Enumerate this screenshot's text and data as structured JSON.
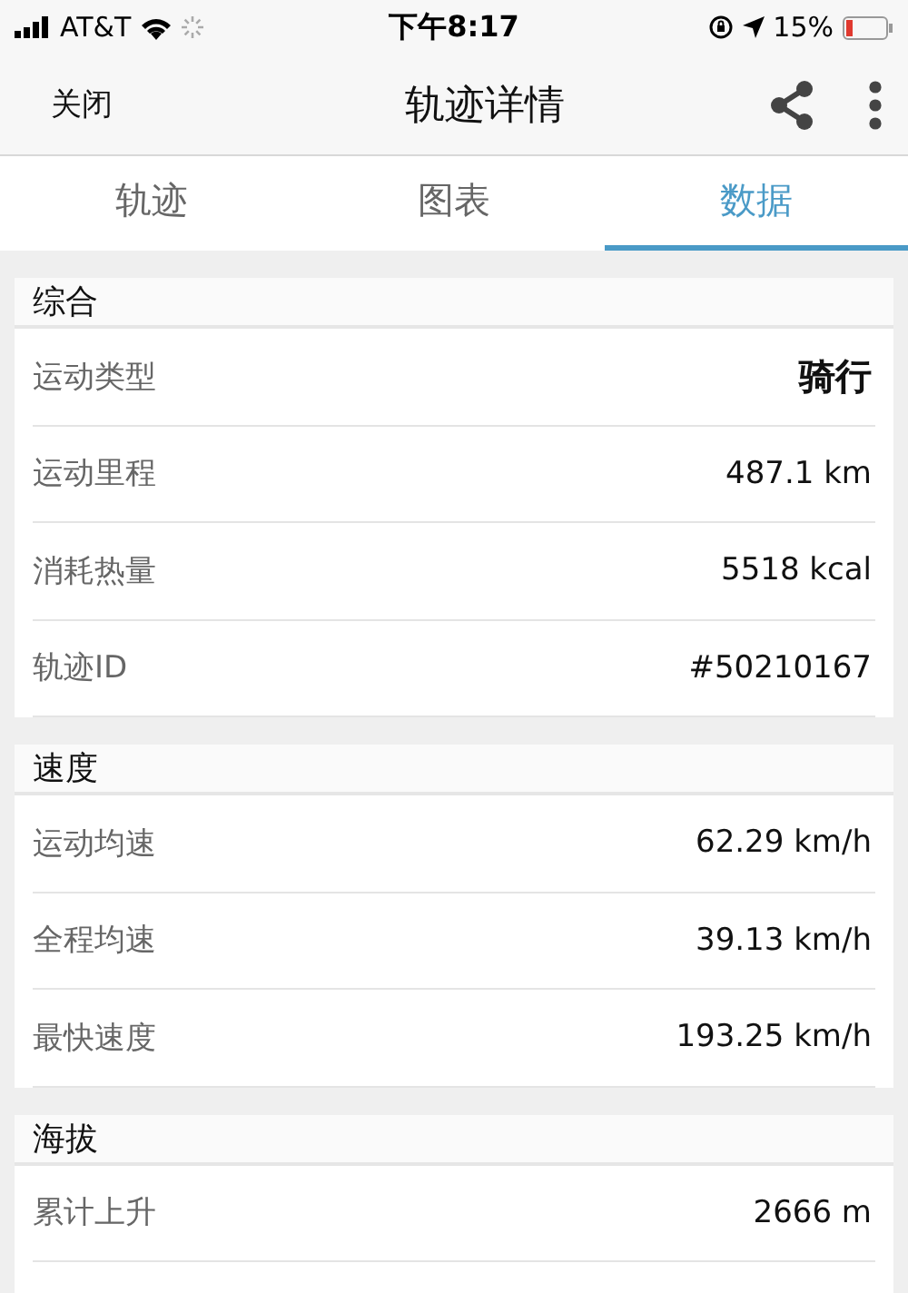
{
  "status_bar": {
    "carrier": "AT&T",
    "time": "下午8:17",
    "battery": "15%"
  },
  "header": {
    "close": "关闭",
    "title": "轨迹详情"
  },
  "tabs": [
    {
      "label": "轨迹",
      "selected": false
    },
    {
      "label": "图表",
      "selected": false
    },
    {
      "label": "数据",
      "selected": true
    }
  ],
  "sections": [
    {
      "title": "综合",
      "rows": [
        {
          "label": "运动类型",
          "value": "骑行",
          "bold": true
        },
        {
          "label": "运动里程",
          "value": "487.1 km",
          "bold": false
        },
        {
          "label": "消耗热量",
          "value": "5518 kcal",
          "bold": false
        },
        {
          "label": "轨迹ID",
          "value": "#50210167",
          "bold": false
        }
      ]
    },
    {
      "title": "速度",
      "rows": [
        {
          "label": "运动均速",
          "value": "62.29 km/h",
          "bold": false
        },
        {
          "label": "全程均速",
          "value": "39.13 km/h",
          "bold": false
        },
        {
          "label": "最快速度",
          "value": "193.25 km/h",
          "bold": false
        }
      ]
    },
    {
      "title": "海拔",
      "rows": [
        {
          "label": "累计上升",
          "value": "2666 m",
          "bold": false
        }
      ]
    }
  ]
}
